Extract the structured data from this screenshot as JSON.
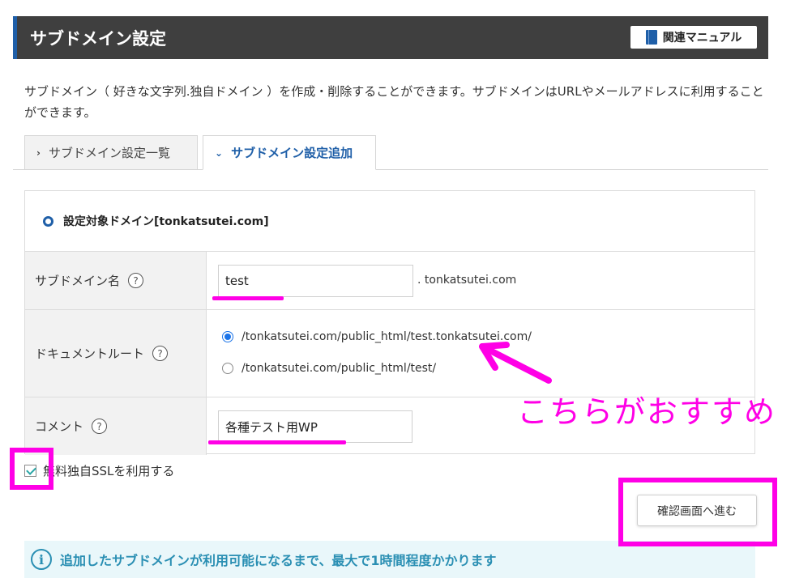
{
  "header": {
    "title": "サブドメイン設定",
    "manual_label": "関連マニュアル"
  },
  "description": "サブドメイン（ 好きな文字列.独自ドメイン ）を作成・削除することができます。サブドメインはURLやメールアドレスに利用することができます。",
  "tabs": [
    {
      "label": "サブドメイン設定一覧",
      "active": false
    },
    {
      "label": "サブドメイン設定追加",
      "active": true
    }
  ],
  "panel": {
    "title": "設定対象ドメイン[tonkatsutei.com]",
    "subdomain": {
      "label": "サブドメイン名",
      "help": "?",
      "value": "test",
      "suffix": ". tonkatsutei.com"
    },
    "docroot": {
      "label": "ドキュメントルート",
      "help": "?",
      "options": [
        {
          "text": "/tonkatsutei.com/public_html/test.tonkatsutei.com/",
          "selected": true
        },
        {
          "text": "/tonkatsutei.com/public_html/test/",
          "selected": false
        }
      ]
    },
    "comment": {
      "label": "コメント",
      "help": "?",
      "value": "各種テスト用WP"
    }
  },
  "ssl": {
    "label": "無料独自SSLを利用する",
    "checked": true
  },
  "confirm_button": "確認画面へ進む",
  "info": {
    "icon": "i",
    "text": "追加したサブドメインが利用可能になるまで、最大で1時間程度かかります"
  },
  "annotation": {
    "text": "こちらがおすすめ",
    "color": "#ff00e6"
  },
  "colors": {
    "accent": "#1f5fa8",
    "header_bg": "#3f3f3f",
    "info_text": "#2a8fb3",
    "annotation": "#ff00e6"
  }
}
